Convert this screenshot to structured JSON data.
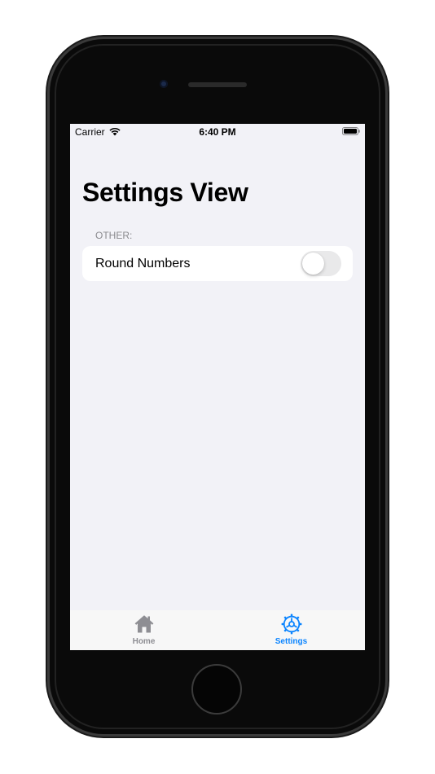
{
  "status_bar": {
    "carrier": "Carrier",
    "time": "6:40 PM",
    "icons": [
      "wifi-icon",
      "battery-icon"
    ]
  },
  "page": {
    "title": "Settings View"
  },
  "sections": [
    {
      "header": "OTHER:",
      "rows": [
        {
          "label": "Round Numbers",
          "control": "toggle",
          "value": false
        }
      ]
    }
  ],
  "tab_bar": {
    "tabs": [
      {
        "label": "Home",
        "icon": "house-icon",
        "selected": false
      },
      {
        "label": "Settings",
        "icon": "gear-icon",
        "selected": true
      }
    ]
  },
  "colors": {
    "accent": "#0a84ff",
    "inactive_tab": "#8e8e93",
    "background": "#f2f2f7",
    "toggle_off": "#e9e9ea"
  }
}
